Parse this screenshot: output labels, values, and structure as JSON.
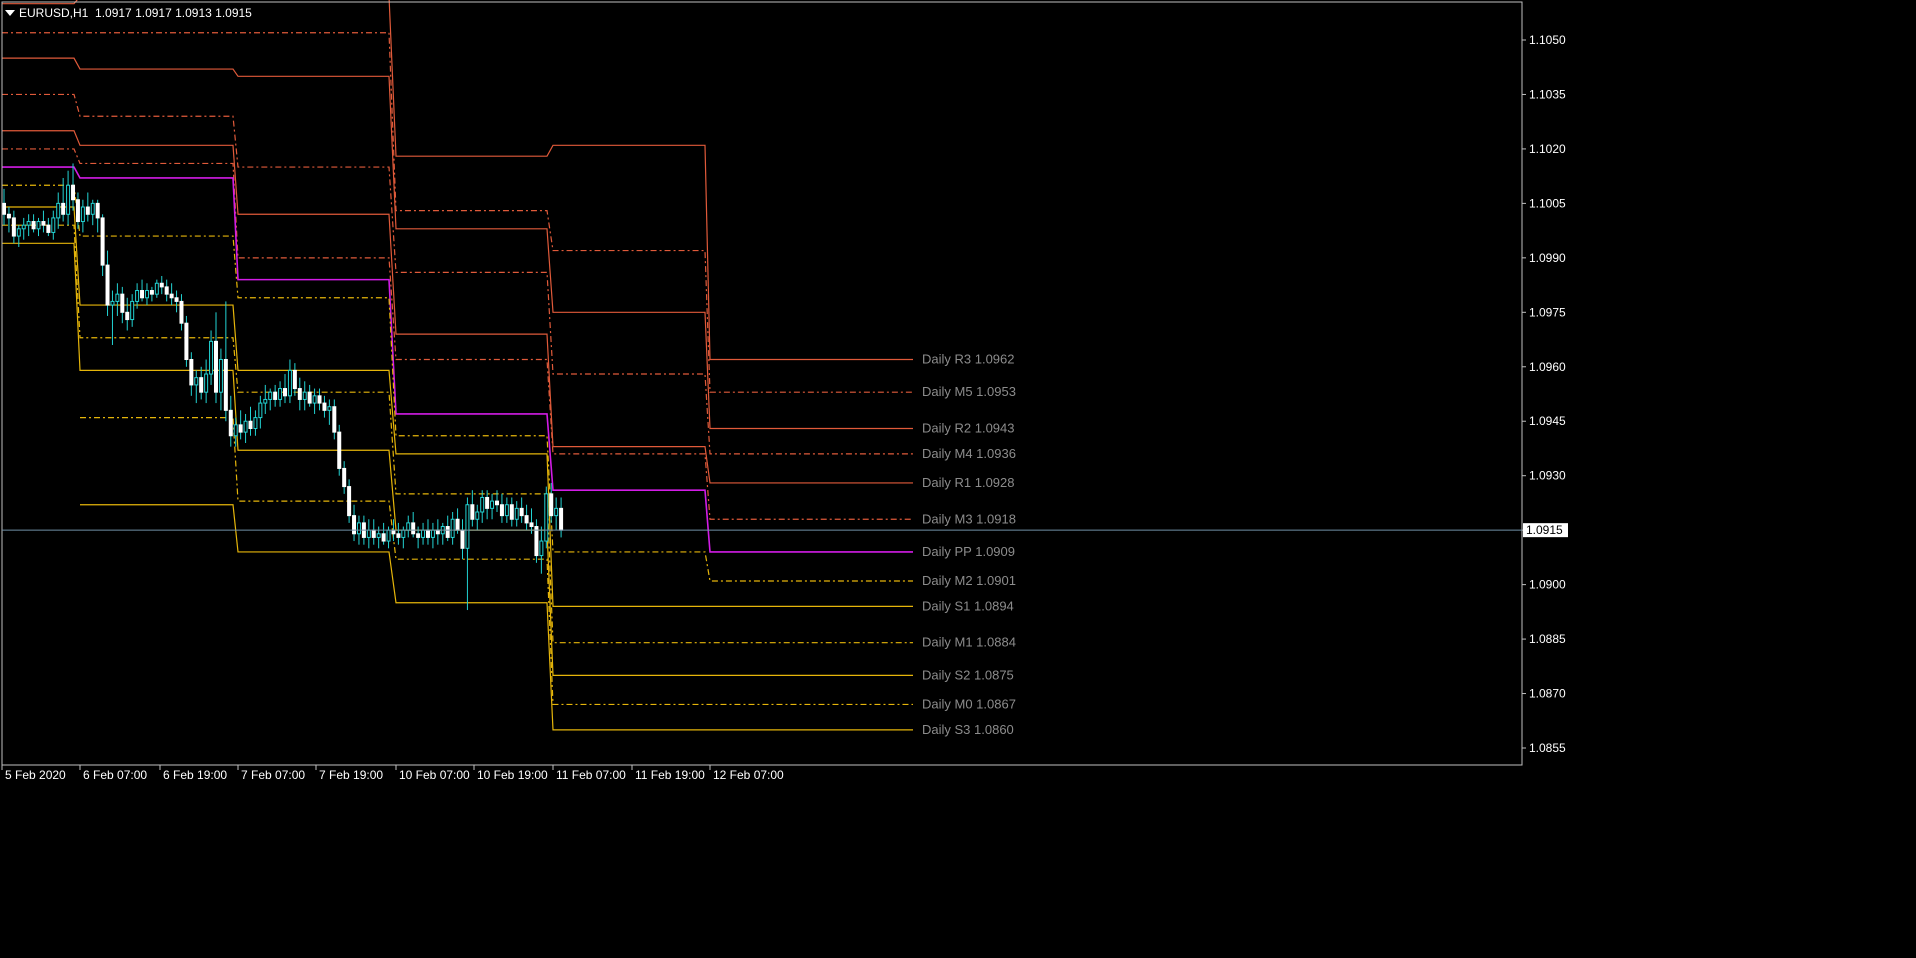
{
  "header": {
    "symbol": "EURUSD,H1",
    "ohlc": "1.0917 1.0917 1.0913 1.0915"
  },
  "colors": {
    "background": "#000000",
    "axis": "#c0c0c0",
    "candle_up": "#22d3d3",
    "candle_down": "#ffffff",
    "resistance": "#e05a3a",
    "support": "#e5b50a",
    "pivot": "#d21ce6",
    "current_price_line": "#6f8fa6",
    "level_label": "#8c8c8c"
  },
  "chart_data": {
    "type": "candlestick",
    "title": "",
    "ylim": [
      1.085,
      1.1062
    ],
    "y_ticks": [
      "1.1050",
      "1.1035",
      "1.1020",
      "1.1005",
      "1.0990",
      "1.0975",
      "1.0960",
      "1.0945",
      "1.0930",
      "1.0915",
      "1.0900",
      "1.0885",
      "1.0870",
      "1.0855"
    ],
    "x_ticks": [
      "5 Feb 2020",
      "6 Feb 07:00",
      "6 Feb 19:00",
      "7 Feb 07:00",
      "7 Feb 19:00",
      "10 Feb 07:00",
      "10 Feb 19:00",
      "11 Feb 07:00",
      "11 Feb 19:00",
      "12 Feb 07:00"
    ],
    "current_price": "1.0915",
    "pivot_days": [
      {
        "day": "5 Feb",
        "R3": 1.106,
        "M5": 1.1052,
        "R2": 1.1045,
        "M4": 1.1035,
        "R1": 1.1025,
        "M3": 1.102,
        "PP": 1.1015,
        "M2": 1.101,
        "S1": 1.1004,
        "M1": 1.0999,
        "S2": 1.0994
      },
      {
        "day": "6 Feb",
        "R3": 1.1062,
        "M5": 1.1052,
        "R2": 1.1042,
        "M4": 1.1029,
        "R1": 1.1021,
        "M3": 1.1016,
        "PP": 1.1012,
        "M2": 1.0996,
        "S1": 1.0977,
        "M1": 1.0968,
        "S2": 1.0959,
        "M0": 1.0946,
        "S3": 1.0922
      },
      {
        "day": "7 Feb",
        "R3": 1.1062,
        "M5": 1.1052,
        "R2": 1.104,
        "M4": 1.1015,
        "R1": 1.1002,
        "M3": 1.099,
        "PP": 1.0984,
        "M2": 1.0979,
        "S1": 1.0959,
        "M1": 1.0953,
        "S2": 1.0937,
        "M0": 1.0923,
        "S3": 1.0909
      },
      {
        "day": "10 Feb",
        "R3": 1.1018,
        "M5": 1.1003,
        "R2": 1.0998,
        "M4": 1.0986,
        "R1": 1.0969,
        "M3": 1.0962,
        "PP": 1.0947,
        "M2": 1.0941,
        "S1": 1.0936,
        "M1": 1.0925,
        "S2": 1.0915,
        "M0": 1.0907,
        "S3": 1.0895
      },
      {
        "day": "11 Feb",
        "R3": 1.1021,
        "M5": 1.0992,
        "R2": 1.0975,
        "M4": 1.0958,
        "R1": 1.0938,
        "M3": 1.0936,
        "PP": 1.0926,
        "M2": 1.0909,
        "S1": 1.0894,
        "M1": 1.0884,
        "S2": 1.0875,
        "M0": 1.0867,
        "S3": 1.086
      },
      {
        "day": "12 Feb",
        "R3": 1.0962,
        "M5": 1.0953,
        "R2": 1.0943,
        "M4": 1.0936,
        "R1": 1.0928,
        "M3": 1.0918,
        "PP": 1.0909,
        "M2": 1.0901,
        "S1": 1.0894,
        "M1": 1.0884,
        "S2": 1.0875,
        "M0": 1.0867,
        "S3": 1.086
      }
    ],
    "level_labels": [
      {
        "text": "Daily R3 1.0962",
        "value": 1.0962
      },
      {
        "text": "Daily M5 1.0953",
        "value": 1.0953
      },
      {
        "text": "Daily R2 1.0943",
        "value": 1.0943
      },
      {
        "text": "Daily M4 1.0936",
        "value": 1.0936
      },
      {
        "text": "Daily R1 1.0928",
        "value": 1.0928
      },
      {
        "text": "Daily M3 1.0918",
        "value": 1.0918
      },
      {
        "text": "Daily PP 1.0909",
        "value": 1.0909
      },
      {
        "text": "Daily M2 1.0901",
        "value": 1.0901
      },
      {
        "text": "Daily S1 1.0894",
        "value": 1.0894
      },
      {
        "text": "Daily M1 1.0884",
        "value": 1.0884
      },
      {
        "text": "Daily S2 1.0875",
        "value": 1.0875
      },
      {
        "text": "Daily M0 1.0867",
        "value": 1.0867
      },
      {
        "text": "Daily S3 1.0860",
        "value": 1.086
      }
    ],
    "candles": [
      [
        1.1005,
        1.1009,
        1.0999,
        1.1002
      ],
      [
        1.1002,
        1.1004,
        1.0997,
        1.1001
      ],
      [
        1.1001,
        1.1003,
        1.0994,
        1.0996
      ],
      [
        1.0996,
        1.0999,
        1.0993,
        1.0998
      ],
      [
        1.0998,
        1.1001,
        1.0995,
        1.0999
      ],
      [
        1.0999,
        1.1002,
        1.0996,
        1.1
      ],
      [
        1.1,
        1.1002,
        1.0997,
        1.0998
      ],
      [
        1.0998,
        1.1001,
        1.0996,
        1.1
      ],
      [
        1.1,
        1.1003,
        1.0997,
        1.0999
      ],
      [
        1.0999,
        1.1001,
        1.0996,
        1.0997
      ],
      [
        1.0997,
        1.1003,
        1.0995,
        1.1001
      ],
      [
        1.1001,
        1.1008,
        1.0998,
        1.1005
      ],
      [
        1.1005,
        1.1012,
        1.1,
        1.1002
      ],
      [
        1.1002,
        1.1014,
        1.0999,
        1.101
      ],
      [
        1.101,
        1.1016,
        1.1003,
        1.1006
      ],
      [
        1.1006,
        1.1008,
        1.0998,
        1.1
      ],
      [
        1.1,
        1.1006,
        1.0997,
        1.1004
      ],
      [
        1.1004,
        1.1008,
        1.1,
        1.1002
      ],
      [
        1.1002,
        1.1006,
        1.0999,
        1.1005
      ],
      [
        1.1005,
        1.1006,
        1.0997,
        1.1001
      ],
      [
        1.1001,
        1.1002,
        1.0985,
        1.0988
      ],
      [
        1.0988,
        1.0992,
        1.0974,
        1.0977
      ],
      [
        1.0977,
        1.0981,
        1.0966,
        1.0978
      ],
      [
        1.0978,
        1.0983,
        1.0974,
        1.098
      ],
      [
        1.098,
        1.0982,
        1.0972,
        1.0975
      ],
      [
        1.0975,
        1.0979,
        1.097,
        1.0973
      ],
      [
        1.0973,
        1.098,
        1.0971,
        1.0978
      ],
      [
        1.0978,
        1.0983,
        1.0976,
        1.0981
      ],
      [
        1.0981,
        1.0984,
        1.0978,
        1.0979
      ],
      [
        1.0979,
        1.0983,
        1.0977,
        1.0981
      ],
      [
        1.0981,
        1.0982,
        1.0978,
        1.098
      ],
      [
        1.098,
        1.0984,
        1.0979,
        1.0983
      ],
      [
        1.0983,
        1.0985,
        1.098,
        1.0982
      ],
      [
        1.0982,
        1.0984,
        1.0978,
        1.098
      ],
      [
        1.098,
        1.0983,
        1.0977,
        1.0979
      ],
      [
        1.0979,
        1.0981,
        1.0975,
        1.0978
      ],
      [
        1.0978,
        1.098,
        1.097,
        1.0972
      ],
      [
        1.0972,
        1.0974,
        1.096,
        1.0962
      ],
      [
        1.0962,
        1.0964,
        1.0952,
        1.0955
      ],
      [
        1.0955,
        1.0959,
        1.095,
        1.0957
      ],
      [
        1.0957,
        1.096,
        1.0951,
        1.0953
      ],
      [
        1.0953,
        1.0962,
        1.095,
        1.0958
      ],
      [
        1.0958,
        1.097,
        1.0955,
        1.0967
      ],
      [
        1.0967,
        1.0975,
        1.095,
        1.0953
      ],
      [
        1.0953,
        1.0965,
        1.0948,
        1.0962
      ],
      [
        1.0962,
        1.0978,
        1.0945,
        1.0948
      ],
      [
        1.0948,
        1.0952,
        1.0938,
        1.0941
      ],
      [
        1.0941,
        1.0946,
        1.0938,
        1.0944
      ],
      [
        1.0944,
        1.0948,
        1.094,
        1.0942
      ],
      [
        1.0942,
        1.0947,
        1.0939,
        1.0945
      ],
      [
        1.0945,
        1.0949,
        1.0941,
        1.0943
      ],
      [
        1.0943,
        1.0948,
        1.0941,
        1.0946
      ],
      [
        1.0946,
        1.0952,
        1.0943,
        1.095
      ],
      [
        1.095,
        1.0955,
        1.0947,
        1.0951
      ],
      [
        1.0951,
        1.0954,
        1.0948,
        1.0953
      ],
      [
        1.0953,
        1.0955,
        1.0949,
        1.0951
      ],
      [
        1.0951,
        1.0956,
        1.0949,
        1.0954
      ],
      [
        1.0954,
        1.0958,
        1.095,
        1.0952
      ],
      [
        1.0952,
        1.0962,
        1.095,
        1.0959
      ],
      [
        1.0959,
        1.0961,
        1.0952,
        1.0954
      ],
      [
        1.0954,
        1.0957,
        1.0948,
        1.0951
      ],
      [
        1.0951,
        1.0956,
        1.0948,
        1.0953
      ],
      [
        1.0953,
        1.0955,
        1.0949,
        1.095
      ],
      [
        1.095,
        1.0954,
        1.0947,
        1.0952
      ],
      [
        1.0952,
        1.0954,
        1.0948,
        1.095
      ],
      [
        1.095,
        1.0952,
        1.0946,
        1.0948
      ],
      [
        1.0948,
        1.0951,
        1.0944,
        1.0949
      ],
      [
        1.0949,
        1.0951,
        1.094,
        1.0942
      ],
      [
        1.0942,
        1.0944,
        1.093,
        1.0932
      ],
      [
        1.0932,
        1.0934,
        1.0925,
        1.0927
      ],
      [
        1.0927,
        1.0929,
        1.0917,
        1.0919
      ],
      [
        1.0919,
        1.0922,
        1.0912,
        1.0914
      ],
      [
        1.0914,
        1.0919,
        1.0911,
        1.0917
      ],
      [
        1.0917,
        1.0919,
        1.0911,
        1.0913
      ],
      [
        1.0913,
        1.0918,
        1.091,
        1.0915
      ],
      [
        1.0915,
        1.0918,
        1.0911,
        1.0913
      ],
      [
        1.0913,
        1.0916,
        1.091,
        1.0914
      ],
      [
        1.0914,
        1.0917,
        1.0911,
        1.0912
      ],
      [
        1.0912,
        1.0916,
        1.091,
        1.0915
      ],
      [
        1.0915,
        1.0918,
        1.0912,
        1.0914
      ],
      [
        1.0914,
        1.0917,
        1.0911,
        1.0913
      ],
      [
        1.0913,
        1.0916,
        1.091,
        1.0915
      ],
      [
        1.0915,
        1.0919,
        1.0913,
        1.0917
      ],
      [
        1.0917,
        1.092,
        1.0913,
        1.0914
      ],
      [
        1.0914,
        1.0916,
        1.091,
        1.0913
      ],
      [
        1.0913,
        1.0917,
        1.0911,
        1.0915
      ],
      [
        1.0915,
        1.0918,
        1.0911,
        1.0913
      ],
      [
        1.0913,
        1.0917,
        1.091,
        1.0915
      ],
      [
        1.0915,
        1.0918,
        1.0911,
        1.0914
      ],
      [
        1.0914,
        1.0917,
        1.0911,
        1.0916
      ],
      [
        1.0916,
        1.0919,
        1.0912,
        1.0913
      ],
      [
        1.0913,
        1.092,
        1.0911,
        1.0918
      ],
      [
        1.0918,
        1.0921,
        1.0914,
        1.0915
      ],
      [
        1.0915,
        1.0918,
        1.0907,
        1.091
      ],
      [
        1.091,
        1.0924,
        1.0893,
        1.0922
      ],
      [
        1.0922,
        1.0926,
        1.0916,
        1.0918
      ],
      [
        1.0918,
        1.0922,
        1.0915,
        1.092
      ],
      [
        1.092,
        1.0926,
        1.0917,
        1.0924
      ],
      [
        1.0924,
        1.0926,
        1.0918,
        1.0921
      ],
      [
        1.0921,
        1.0925,
        1.0918,
        1.0923
      ],
      [
        1.0923,
        1.0926,
        1.092,
        1.0922
      ],
      [
        1.0922,
        1.0925,
        1.0917,
        1.0919
      ],
      [
        1.0919,
        1.0924,
        1.0917,
        1.0922
      ],
      [
        1.0922,
        1.0924,
        1.0916,
        1.0918
      ],
      [
        1.0918,
        1.0923,
        1.0916,
        1.0921
      ],
      [
        1.0921,
        1.0924,
        1.0917,
        1.0919
      ],
      [
        1.0919,
        1.0922,
        1.0915,
        1.0917
      ],
      [
        1.0917,
        1.0921,
        1.0914,
        1.0916
      ],
      [
        1.0916,
        1.0918,
        1.0906,
        1.0908
      ],
      [
        1.0908,
        1.0916,
        1.0903,
        1.0912
      ],
      [
        1.0912,
        1.0927,
        1.091,
        1.0925
      ],
      [
        1.0925,
        1.0928,
        1.0917,
        1.0919
      ],
      [
        1.0919,
        1.0924,
        1.0915,
        1.0921
      ],
      [
        1.0921,
        1.0924,
        1.0913,
        1.0915
      ]
    ]
  }
}
